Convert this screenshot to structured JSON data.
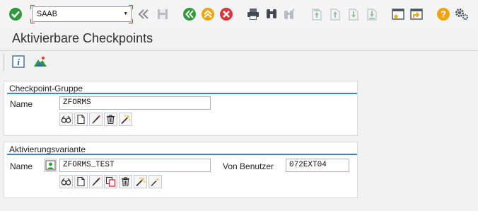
{
  "toolbar": {
    "command_field_value": "SAAB",
    "icons": [
      "enter-icon",
      "back-history-icon",
      "save-icon",
      "back-icon",
      "exit-icon",
      "cancel-icon",
      "print-icon",
      "find-icon",
      "find-next-icon",
      "first-page-icon",
      "previous-page-icon",
      "next-page-icon",
      "last-page-icon",
      "create-session-icon",
      "shortcut-icon",
      "help-icon",
      "settings-icon"
    ]
  },
  "page": {
    "title": "Aktivierbare Checkpoints"
  },
  "app_toolbar": {
    "icons": [
      "info-icon",
      "landscape-icon"
    ]
  },
  "checkpoint_group": {
    "title": "Checkpoint-Gruppe",
    "name_label": "Name",
    "name_value": "ZFORMS",
    "buttons": [
      "display-icon",
      "create-icon",
      "change-icon",
      "delete-icon",
      "wizard-icon"
    ]
  },
  "activation_variant": {
    "title": "Aktivierungsvariante",
    "name_label": "Name",
    "name_value": "ZFORMS_TEST",
    "user_label": "Von Benutzer",
    "user_value": "072EXT04",
    "buttons": [
      "display-icon",
      "create-icon",
      "change-icon",
      "copy-icon",
      "delete-icon",
      "wizard-icon",
      "wizard-small-icon"
    ]
  },
  "colors": {
    "accent_blue": "#3a89b8",
    "green": "#2e9a3a",
    "orange": "#f0a30a",
    "red": "#d9353b"
  }
}
